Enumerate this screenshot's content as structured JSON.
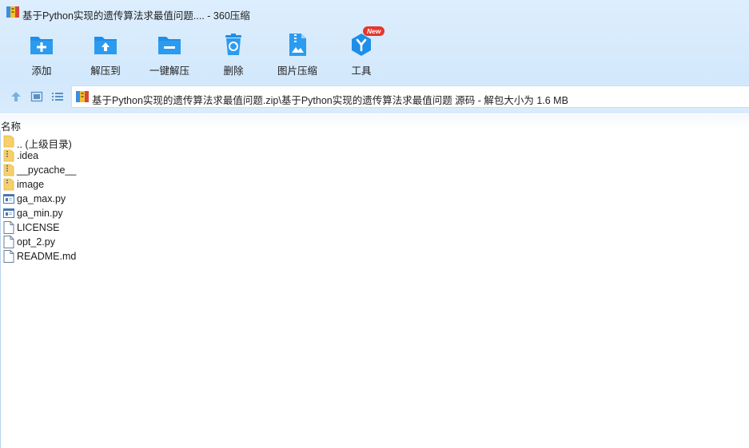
{
  "window": {
    "title": "基于Python实现的遗传算法求最值问题.... - 360压缩",
    "app_icon": "archive-icon"
  },
  "toolbar": {
    "items": [
      {
        "label": "添加",
        "icon": "add-folder-icon"
      },
      {
        "label": "解压到",
        "icon": "extract-to-icon"
      },
      {
        "label": "一键解压",
        "icon": "one-click-extract-icon"
      },
      {
        "label": "删除",
        "icon": "recycle-bin-icon"
      },
      {
        "label": "图片压缩",
        "icon": "image-compress-icon"
      },
      {
        "label": "工具",
        "icon": "tools-icon",
        "badge": "New"
      }
    ]
  },
  "nav": {
    "path": "基于Python实现的遗传算法求最值问题.zip\\基于Python实现的遗传算法求最值问题 源码 - 解包大小为 1.6 MB"
  },
  "list": {
    "column_name": "名称",
    "files": [
      {
        "name": ".. (上级目录)",
        "type": "folder"
      },
      {
        "name": ".idea",
        "type": "folder"
      },
      {
        "name": "__pycache__",
        "type": "folder"
      },
      {
        "name": "image",
        "type": "folder"
      },
      {
        "name": "ga_max.py",
        "type": "py"
      },
      {
        "name": "ga_min.py",
        "type": "py"
      },
      {
        "name": "LICENSE",
        "type": "file"
      },
      {
        "name": "opt_2.py",
        "type": "file"
      },
      {
        "name": "README.md",
        "type": "file"
      }
    ]
  },
  "colors": {
    "accent": "#1e8ee9",
    "folder": "#f7d06b",
    "badge": "#e8352b",
    "toolbar_bg": "#d2e8fc"
  }
}
